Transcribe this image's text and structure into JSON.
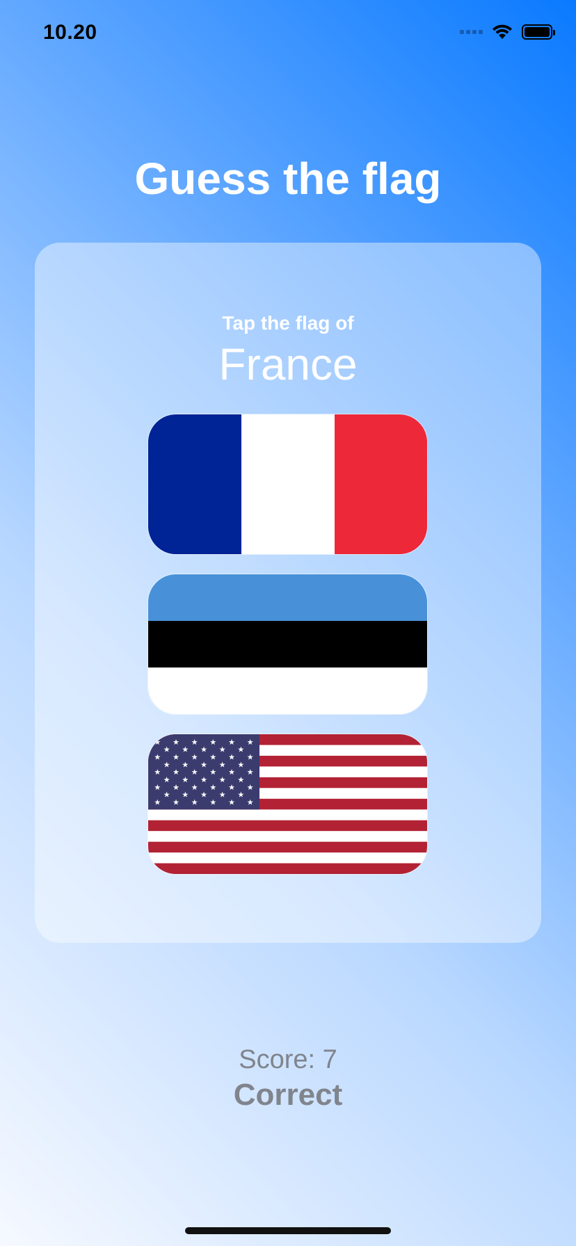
{
  "status_bar": {
    "time": "10.20",
    "icons": [
      "cellular-signal-icon",
      "wifi-icon",
      "battery-icon"
    ]
  },
  "title": "Guess the flag",
  "question": {
    "prompt": "Tap the flag of",
    "country": "France"
  },
  "flags": [
    {
      "country": "France",
      "icon": "france-flag-icon"
    },
    {
      "country": "Estonia",
      "icon": "estonia-flag-icon"
    },
    {
      "country": "United States",
      "icon": "us-flag-icon"
    }
  ],
  "score": {
    "text": "Score: 7",
    "value": 7,
    "result": "Correct"
  },
  "colors": {
    "background_top": "#0a7aff",
    "background_bottom": "#f6f9ff",
    "title_text": "#ffffff",
    "score_text": "#80848c",
    "france_blue": "#002395",
    "france_red": "#ed2939",
    "estonia_blue": "#4891d9",
    "us_red": "#b22234",
    "us_blue": "#3c3b6e"
  }
}
